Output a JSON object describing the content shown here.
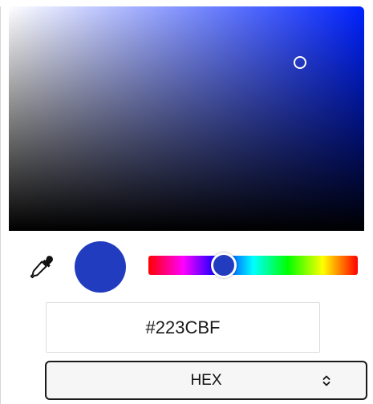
{
  "picker": {
    "hue_degrees": 230,
    "saturation_percent": 82,
    "value_percent": 75,
    "selected_color": "#223CBF",
    "hue_color": "#0022ff"
  },
  "hex_input": {
    "value": "#223CBF"
  },
  "format_select": {
    "selected": "HEX"
  },
  "icons": {
    "eyedropper": "eyedropper-icon",
    "select_arrows": "updown-chevron-icon"
  }
}
